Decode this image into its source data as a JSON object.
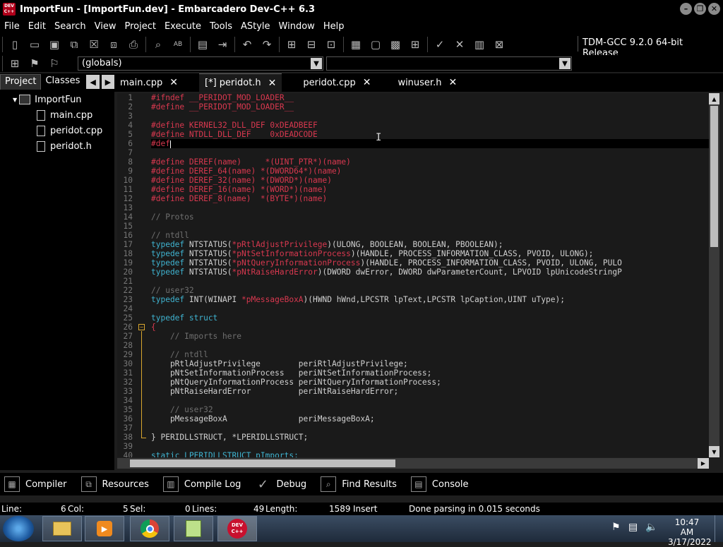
{
  "window": {
    "title": "ImportFun - [ImportFun.dev] - Embarcadero Dev-C++ 6.3",
    "icon_text": "DEV C++"
  },
  "menu": [
    "File",
    "Edit",
    "Search",
    "View",
    "Project",
    "Execute",
    "Tools",
    "AStyle",
    "Window",
    "Help"
  ],
  "toolbar": {
    "compiler": "TDM-GCC 9.2.0 64-bit Release",
    "scope_select": "(globals)"
  },
  "left_panel": {
    "tabs": [
      "Project",
      "Classes"
    ],
    "project": "ImportFun",
    "files": [
      "main.cpp",
      "peridot.cpp",
      "peridot.h"
    ]
  },
  "editor_tabs": [
    {
      "label": "main.cpp",
      "close": "✕"
    },
    {
      "label": "[*] peridot.h",
      "close": "✕"
    },
    {
      "label": "peridot.cpp",
      "close": "✕"
    },
    {
      "label": "winuser.h",
      "close": "✕"
    }
  ],
  "code": {
    "line_numbers": [
      "1",
      "2",
      "3",
      "4",
      "5",
      "6",
      "7",
      "8",
      "9",
      "10",
      "11",
      "12",
      "13",
      "14",
      "15",
      "16",
      "17",
      "18",
      "19",
      "20",
      "21",
      "22",
      "23",
      "24",
      "25",
      "26",
      "27",
      "28",
      "29",
      "30",
      "31",
      "32",
      "33",
      "34",
      "35",
      "36",
      "37",
      "38",
      "39",
      "40"
    ],
    "lines": [
      {
        "t": "red",
        "s": "#ifndef __PERIDOT_MOD_LOADER__"
      },
      {
        "t": "red",
        "s": "#define __PERIDOT_MOD_LOADER__"
      },
      {
        "t": "plain",
        "s": ""
      },
      {
        "t": "red",
        "s": "#define KERNEL32_DLL_DEF 0xDEADBEEF"
      },
      {
        "t": "red",
        "s": "#define NTDLL_DLL_DEF    0xDEADCODE"
      },
      {
        "t": "red",
        "s": "#def"
      },
      {
        "t": "plain",
        "s": ""
      },
      {
        "t": "red",
        "s": "#define DEREF(name)     *(UINT_PTR*)(name)"
      },
      {
        "t": "red",
        "s": "#define DEREF_64(name) *(DWORD64*)(name)"
      },
      {
        "t": "red",
        "s": "#define DEREF_32(name) *(DWORD*)(name)"
      },
      {
        "t": "red",
        "s": "#define DEREF_16(name) *(WORD*)(name)"
      },
      {
        "t": "red",
        "s": "#define DEREF_8(name)  *(BYTE*)(name)"
      },
      {
        "t": "plain",
        "s": ""
      },
      {
        "t": "cmt",
        "s": "// Protos"
      },
      {
        "t": "plain",
        "s": ""
      },
      {
        "t": "cmt",
        "s": "// ntdll"
      },
      {
        "t": "td",
        "a": "typedef",
        "b": " NTSTATUS(",
        "c": "*pRtlAdjustPrivilege",
        "d": ")(ULONG, BOOLEAN, BOOLEAN, PBOOLEAN);"
      },
      {
        "t": "td",
        "a": "typedef",
        "b": " NTSTATUS(",
        "c": "*pNtSetInformationProcess",
        "d": ")(HANDLE, PROCESS_INFORMATION_CLASS, PVOID, ULONG);"
      },
      {
        "t": "td",
        "a": "typedef",
        "b": " NTSTATUS(",
        "c": "*pNtQueryInformationProcess",
        "d": ")(HANDLE, PROCESS_INFORMATION_CLASS, PVOID, ULONG, PULO"
      },
      {
        "t": "td",
        "a": "typedef",
        "b": " NTSTATUS(",
        "c": "*pNtRaiseHardError",
        "d": ")(DWORD dwError, DWORD dwParameterCount, LPVOID lpUnicodeStringP"
      },
      {
        "t": "plain",
        "s": ""
      },
      {
        "t": "cmt",
        "s": "// user32"
      },
      {
        "t": "td",
        "a": "typedef",
        "b": " INT(WINAPI ",
        "c": "*pMessageBoxA",
        "d": ")(HWND hWnd,LPCSTR lpText,LPCSTR lpCaption,UINT uType);"
      },
      {
        "t": "plain",
        "s": ""
      },
      {
        "t": "kw",
        "s": "typedef struct"
      },
      {
        "t": "red",
        "s": "{"
      },
      {
        "t": "cmt",
        "s": "    // Imports here"
      },
      {
        "t": "plain",
        "s": ""
      },
      {
        "t": "cmt",
        "s": "    // ntdll"
      },
      {
        "t": "ty",
        "s": "    pRtlAdjustPrivilege        periRtlAdjustPrivilege;"
      },
      {
        "t": "ty",
        "s": "    pNtSetInformationProcess   periNtSetInformationProcess;"
      },
      {
        "t": "ty",
        "s": "    pNtQueryInformationProcess periNtQueryInformationProcess;"
      },
      {
        "t": "ty",
        "s": "    pNtRaiseHardError          periNtRaiseHardError;"
      },
      {
        "t": "plain",
        "s": ""
      },
      {
        "t": "cmt",
        "s": "    // user32"
      },
      {
        "t": "ty",
        "s": "    pMessageBoxA               periMessageBoxA;"
      },
      {
        "t": "plain",
        "s": ""
      },
      {
        "t": "ty",
        "s": "} PERIDLLSTRUCT, *LPERIDLLSTRUCT;"
      },
      {
        "t": "plain",
        "s": ""
      },
      {
        "t": "kw",
        "s": "static LPERIDLLSTRUCT pImports;"
      }
    ],
    "current_line": 6
  },
  "bottom_tabs": [
    "Compiler",
    "Resources",
    "Compile Log",
    "Debug",
    "Find Results",
    "Console"
  ],
  "status": {
    "line": "Line:",
    "line_val": "6",
    "col": "Col:",
    "col_val": "5",
    "sel": "Sel:",
    "sel_val": "0",
    "lines": "Lines:",
    "lines_val": "49",
    "length": "Length:",
    "length_val": "1589",
    "mode": "Insert",
    "message": "Done parsing in 0.015 seconds"
  },
  "taskbar": {
    "time": "10:47 AM",
    "date": "3/17/2022"
  }
}
